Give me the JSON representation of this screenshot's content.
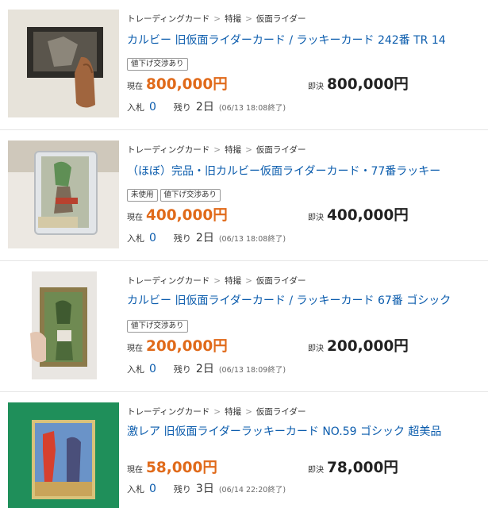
{
  "labels": {
    "current": "現在",
    "buy_now": "即決",
    "bids": "入札",
    "remaining": "残り"
  },
  "items": [
    {
      "breadcrumb": [
        "トレーディングカード",
        "特撮",
        "仮面ライダー"
      ],
      "title": "カルビー 旧仮面ライダーカード / ラッキーカード 242番 TR 14",
      "badges": [
        "値下げ交渉あり"
      ],
      "current_price": "800,000円",
      "buy_now_price": "800,000円",
      "bids": "0",
      "time_left": "2日",
      "end_time": "(06/13 18:08終了)"
    },
    {
      "breadcrumb": [
        "トレーディングカード",
        "特撮",
        "仮面ライダー"
      ],
      "title": "（ほぼ）完品・旧カルビー仮面ライダーカード・77番ラッキー",
      "badges": [
        "未使用",
        "値下げ交渉あり"
      ],
      "current_price": "400,000円",
      "buy_now_price": "400,000円",
      "bids": "0",
      "time_left": "2日",
      "end_time": "(06/13 18:08終了)"
    },
    {
      "breadcrumb": [
        "トレーディングカード",
        "特撮",
        "仮面ライダー"
      ],
      "title": "カルビー 旧仮面ライダーカード / ラッキーカード 67番 ゴシック",
      "badges": [
        "値下げ交渉あり"
      ],
      "current_price": "200,000円",
      "buy_now_price": "200,000円",
      "bids": "0",
      "time_left": "2日",
      "end_time": "(06/13 18:09終了)"
    },
    {
      "breadcrumb": [
        "トレーディングカード",
        "特撮",
        "仮面ライダー"
      ],
      "title": "激レア 旧仮面ライダーラッキーカード NO.59 ゴシック 超美品",
      "badges": [],
      "current_price": "58,000円",
      "buy_now_price": "78,000円",
      "bids": "0",
      "time_left": "3日",
      "end_time": "(06/14 22:20終了)"
    }
  ]
}
